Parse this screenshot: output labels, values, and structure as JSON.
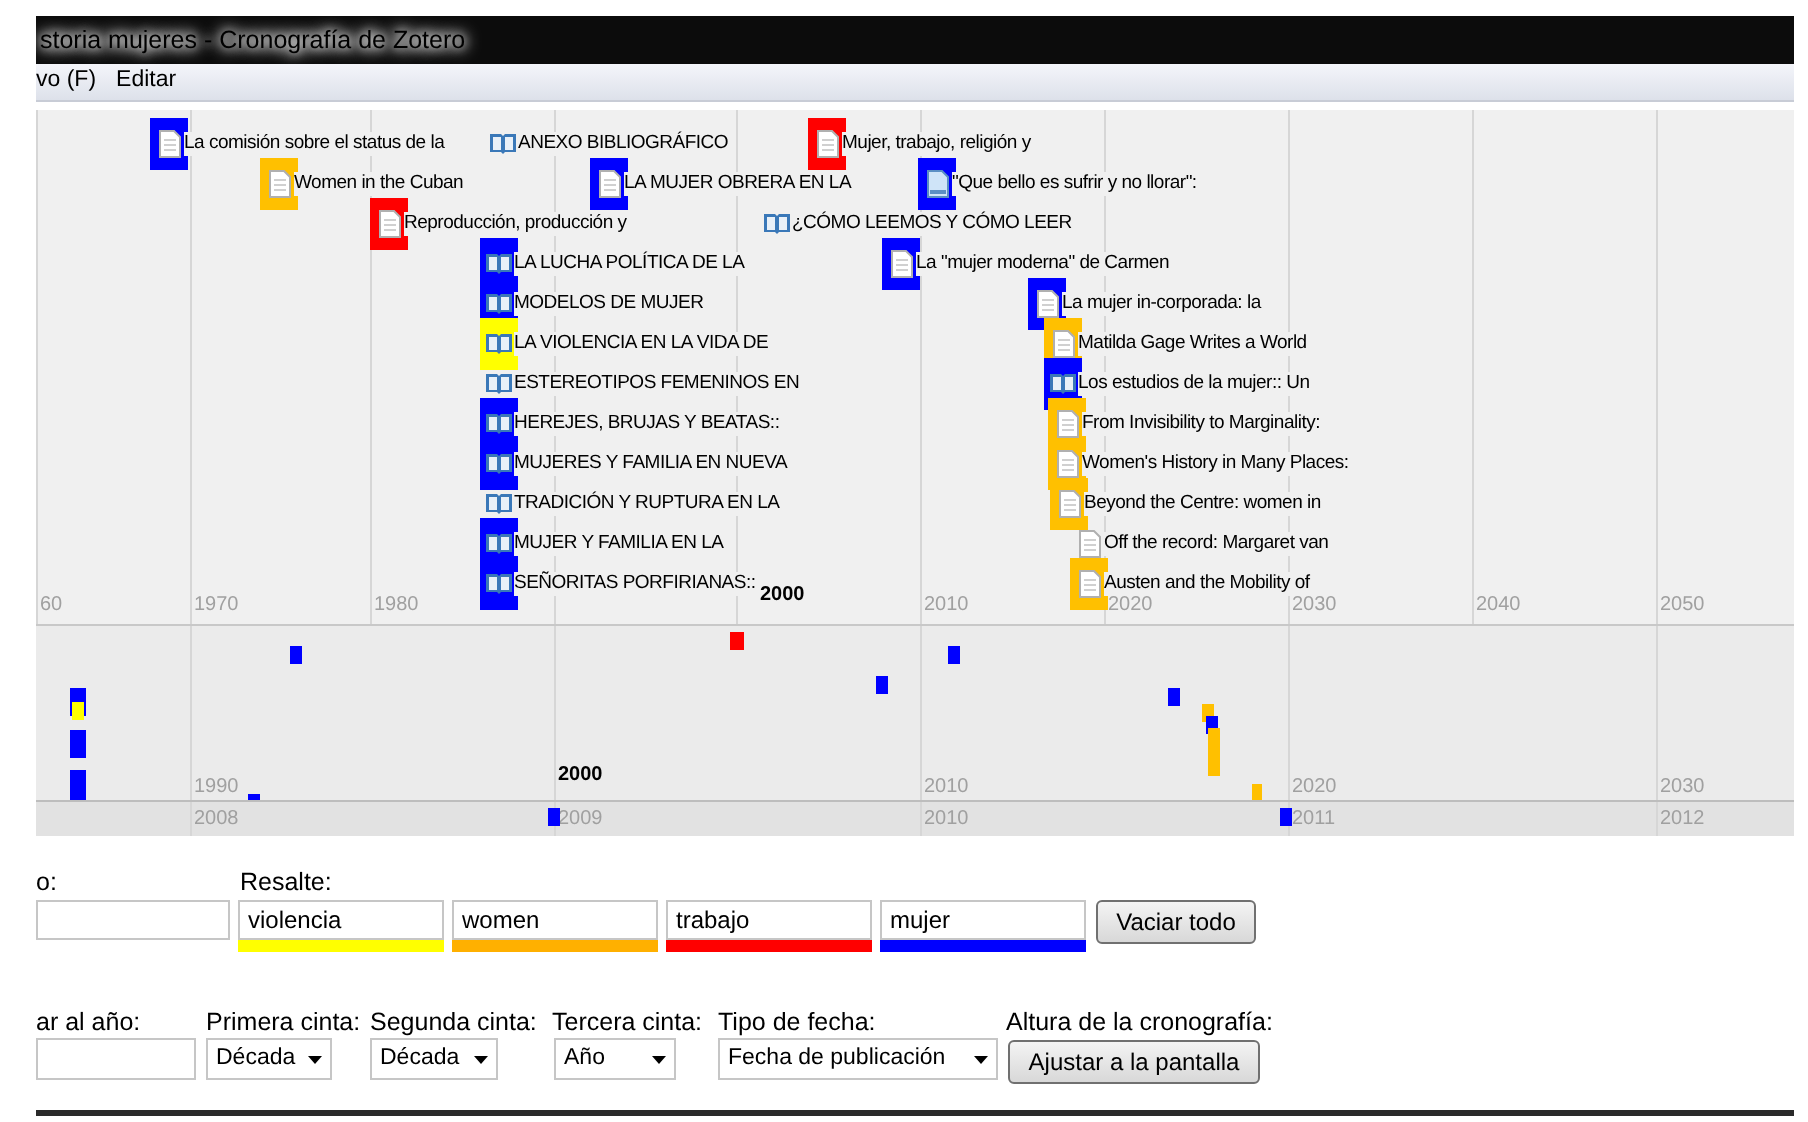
{
  "window": {
    "title": "storia mujeres - Cronografía de Zotero"
  },
  "menu": [
    "vo (F)",
    "Editar"
  ],
  "timeline": {
    "main_band": {
      "tick_labels": [
        "60",
        "1970",
        "1980",
        "2010",
        "2020",
        "2030",
        "2040",
        "2050"
      ],
      "marker_label": "2000",
      "events": [
        {
          "title": "La comisión sobre el status de la",
          "kind": "document",
          "color": "#0000ff"
        },
        {
          "title": "ANEXO BIBLIOGRÁFICO",
          "kind": "book"
        },
        {
          "title": "Mujer, trabajo, religión y",
          "kind": "document",
          "color": "#ff0000"
        },
        {
          "title": "Women in the Cuban",
          "kind": "document",
          "color": "#ffc000"
        },
        {
          "title": "LA MUJER OBRERA EN LA",
          "kind": "document",
          "color": "#0000ff"
        },
        {
          "title": "\"Que bello es sufrir y no llorar\":",
          "kind": "webpage",
          "color": "#0000ff"
        },
        {
          "title": "Reproducción, producción y",
          "kind": "document",
          "color": "#ff0000"
        },
        {
          "title": "¿CÓMO LEEMOS Y CÓMO LEER",
          "kind": "book"
        },
        {
          "title": "LA LUCHA POLÍTICA DE LA",
          "kind": "book",
          "color": "#0000ff"
        },
        {
          "title": "La \"mujer moderna\" de Carmen",
          "kind": "document",
          "color": "#0000ff"
        },
        {
          "title": "MODELOS DE MUJER",
          "kind": "book",
          "color": "#0000ff"
        },
        {
          "title": "La mujer in-corporada: la",
          "kind": "document",
          "color": "#0000ff"
        },
        {
          "title": "LA VIOLENCIA EN LA VIDA DE",
          "kind": "book",
          "color": "#ffff00"
        },
        {
          "title": "Matilda Gage Writes a World",
          "kind": "document",
          "color": "#ffc000"
        },
        {
          "title": "ESTEREOTIPOS FEMENINOS EN",
          "kind": "book"
        },
        {
          "title": "Los estudios de la mujer:: Un",
          "kind": "book",
          "color": "#0000ff"
        },
        {
          "title": "HEREJES, BRUJAS Y BEATAS::",
          "kind": "book",
          "color": "#0000ff"
        },
        {
          "title": "From Invisibility to Marginality:",
          "kind": "document",
          "color": "#ffc000"
        },
        {
          "title": "MUJERES Y FAMILIA EN NUEVA",
          "kind": "book",
          "color": "#0000ff"
        },
        {
          "title": "Women's History in Many Places:",
          "kind": "document",
          "color": "#ffc000"
        },
        {
          "title": "TRADICIÓN Y RUPTURA EN LA",
          "kind": "book"
        },
        {
          "title": "Beyond the Centre: women in",
          "kind": "document",
          "color": "#ffc000"
        },
        {
          "title": "MUJER Y FAMILIA EN LA",
          "kind": "book",
          "color": "#0000ff"
        },
        {
          "title": "Off the record: Margaret van",
          "kind": "document"
        },
        {
          "title": "SEÑORITAS PORFIRIANAS::",
          "kind": "book",
          "color": "#0000ff"
        },
        {
          "title": "Austen and the Mobility of",
          "kind": "document",
          "color": "#ffc000"
        }
      ]
    },
    "decade_band": {
      "tick_labels": [
        "1990",
        "2010",
        "2020",
        "2030"
      ],
      "marker_label": "2000",
      "markers": [
        {
          "color": "#0000ff"
        },
        {
          "color": "#ff0000"
        },
        {
          "color": "#0000ff"
        },
        {
          "color": "#0000ff"
        },
        {
          "color": "#0000ff"
        },
        {
          "color": "#ffff00"
        },
        {
          "color": "#0000ff"
        },
        {
          "color": "#0000ff"
        },
        {
          "color": "#0000ff"
        },
        {
          "color": "#ffc000"
        },
        {
          "color": "#0000ff"
        },
        {
          "color": "#ffc000"
        },
        {
          "color": "#ffc000"
        },
        {
          "color": "#0000ff"
        }
      ]
    },
    "year_band": {
      "tick_labels": [
        "2008",
        "2009",
        "2010",
        "2011",
        "2012"
      ],
      "markers": [
        {
          "color": "#0000ff"
        },
        {
          "color": "#0000ff"
        }
      ]
    }
  },
  "highlight": {
    "filter_label": "o:",
    "label": "Resalte:",
    "fields": [
      {
        "value": "violencia",
        "color": "#ffff00"
      },
      {
        "value": "women",
        "color": "#ffb000"
      },
      {
        "value": "trabajo",
        "color": "#ff0000"
      },
      {
        "value": "mujer",
        "color": "#0000ff"
      }
    ],
    "clear_button": "Vaciar todo"
  },
  "controls": {
    "goto_label": "ar al año:",
    "selects": [
      {
        "label": "Primera cinta:",
        "value": "Década"
      },
      {
        "label": "Segunda cinta:",
        "value": "Década"
      },
      {
        "label": "Tercera cinta:",
        "value": "Año"
      },
      {
        "label": "Tipo de fecha:",
        "value": "Fecha de publicación"
      }
    ],
    "height_label": "Altura de la cronografía:",
    "fit_button": "Ajustar a la pantalla"
  }
}
